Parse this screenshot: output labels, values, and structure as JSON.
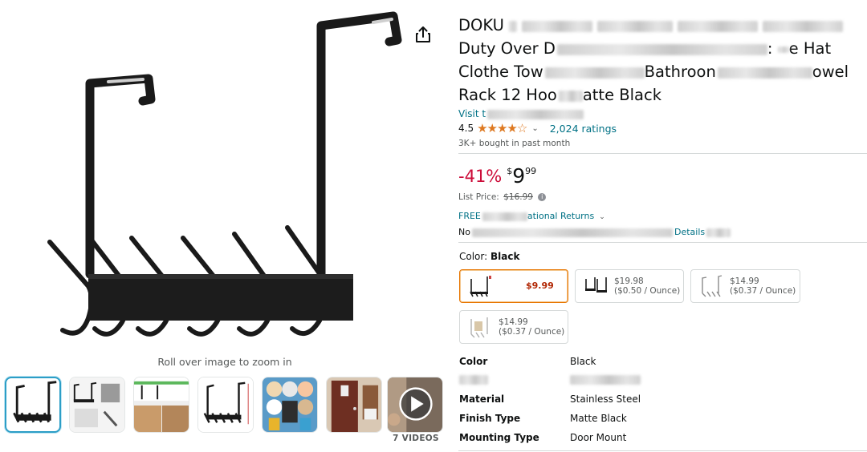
{
  "gallery": {
    "zoom_hint": "Roll over image to zoom in",
    "videos_label": "7 VIDEOS",
    "thumbnails": [
      "thumb-main",
      "thumb-dimensions",
      "thumb-door-fit",
      "thumb-hooks-size",
      "thumb-uses",
      "thumb-door-room",
      "thumb-video"
    ]
  },
  "product": {
    "title_lines": [
      "DOKU",
      "Duty Over D",
      ": ",
      "e Hat",
      "Clothe Tow",
      "Bathroon",
      "owel",
      "Rack 12 Hoo",
      "atte Black"
    ],
    "visit_store": "Visit t",
    "rating_value": "4.5",
    "stars_glyphs": "★★★★☆",
    "ratings_count": "2,024 ratings",
    "bought": "3K+ bought in past month",
    "discount": "-41%",
    "price_currency": "$",
    "price_whole": "9",
    "price_fraction": "99",
    "list_price_label": "List Price:",
    "list_price": "$16.99",
    "returns": "FREE",
    "returns_tail": "ational Returns",
    "import_prefix": "No",
    "import_tail": "Details"
  },
  "color_picker": {
    "label": "Color:",
    "selected": "Black",
    "options": [
      {
        "price": "$9.99",
        "unit": ""
      },
      {
        "price": "$19.98",
        "unit": "($0.50 / Ounce)"
      },
      {
        "price": "$14.99",
        "unit": "($0.37 / Ounce)"
      },
      {
        "price": "$14.99",
        "unit": "($0.37 / Ounce)"
      }
    ]
  },
  "specs": [
    {
      "key": "Color",
      "value": "Black"
    },
    {
      "key": "",
      "value": ""
    },
    {
      "key": "Material",
      "value": "Stainless Steel"
    },
    {
      "key": "Finish Type",
      "value": "Matte Black"
    },
    {
      "key": "Mounting Type",
      "value": "Door Mount"
    }
  ],
  "colors": {
    "link": "#007185",
    "discount": "#cc0c39",
    "star": "#de7921",
    "selected_border": "#e77600",
    "thumb_active_border": "#2c9ec7",
    "sale_price": "#b12704"
  }
}
